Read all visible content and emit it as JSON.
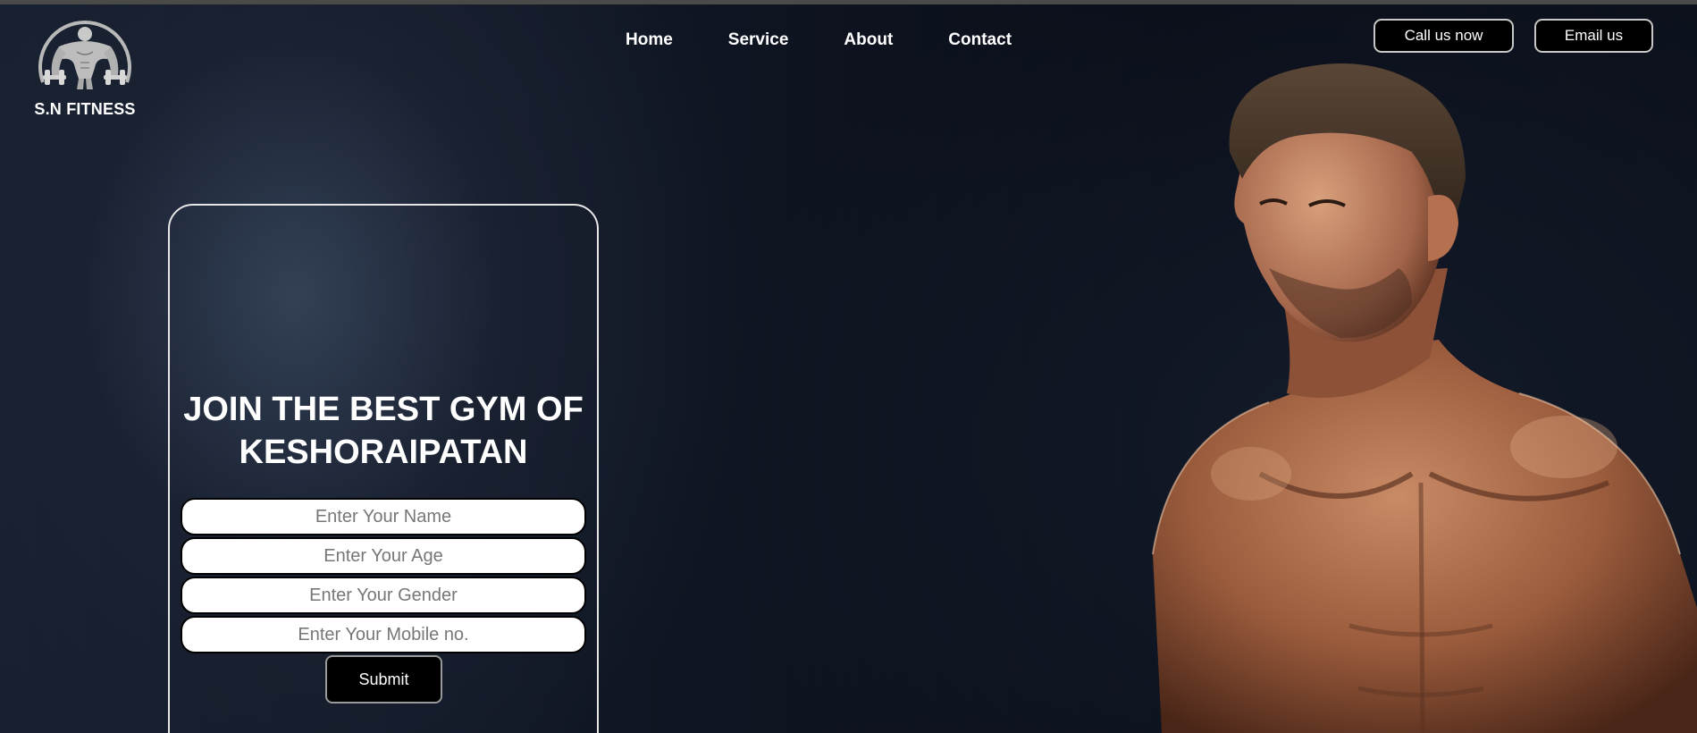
{
  "brand": {
    "name": "S.N FITNESS",
    "logo_icon": "bodybuilder-icon"
  },
  "nav": {
    "items": [
      {
        "label": "Home"
      },
      {
        "label": "Service"
      },
      {
        "label": "About"
      },
      {
        "label": "Contact"
      }
    ]
  },
  "header": {
    "call_label": "Call us now",
    "email_label": "Email us"
  },
  "form": {
    "title": "JOIN THE BEST GYM OF KESHORAIPATAN",
    "name_placeholder": "Enter Your Name",
    "age_placeholder": "Enter Your Age",
    "gender_placeholder": "Enter Your Gender",
    "mobile_placeholder": "Enter Your Mobile no.",
    "submit_label": "Submit"
  },
  "colors": {
    "background": "#0b0f19",
    "button_bg": "#000000",
    "text": "#ffffff"
  }
}
